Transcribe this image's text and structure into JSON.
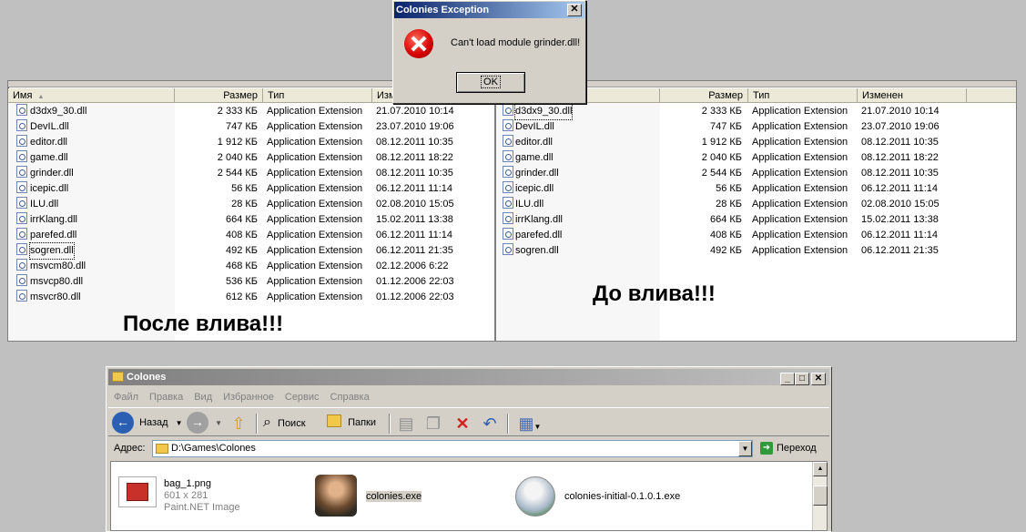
{
  "dialog": {
    "title": "Colonies Exception",
    "close": "✕",
    "message": "Can't load module grinder.dll!",
    "ok": "OK"
  },
  "left_panel": {
    "columns": {
      "name": "Имя",
      "size": "Размер",
      "type": "Тип",
      "modified": "Измен"
    },
    "files": [
      {
        "name": "d3dx9_30.dll",
        "size": "2 333 КБ",
        "type": "Application Extension",
        "date": "21.07.2010 10:14"
      },
      {
        "name": "DevIL.dll",
        "size": "747 КБ",
        "type": "Application Extension",
        "date": "23.07.2010 19:06"
      },
      {
        "name": "editor.dll",
        "size": "1 912 КБ",
        "type": "Application Extension",
        "date": "08.12.2011 10:35"
      },
      {
        "name": "game.dll",
        "size": "2 040 КБ",
        "type": "Application Extension",
        "date": "08.12.2011 18:22"
      },
      {
        "name": "grinder.dll",
        "size": "2 544 КБ",
        "type": "Application Extension",
        "date": "08.12.2011 10:35"
      },
      {
        "name": "icepic.dll",
        "size": "56 КБ",
        "type": "Application Extension",
        "date": "06.12.2011 11:14"
      },
      {
        "name": "ILU.dll",
        "size": "28 КБ",
        "type": "Application Extension",
        "date": "02.08.2010 15:05"
      },
      {
        "name": "irrKlang.dll",
        "size": "664 КБ",
        "type": "Application Extension",
        "date": "15.02.2011 13:38"
      },
      {
        "name": "parefed.dll",
        "size": "408 КБ",
        "type": "Application Extension",
        "date": "06.12.2011 11:14"
      },
      {
        "name": "sogren.dll",
        "size": "492 КБ",
        "type": "Application Extension",
        "date": "06.12.2011 21:35"
      },
      {
        "name": "msvcm80.dll",
        "size": "468 КБ",
        "type": "Application Extension",
        "date": "02.12.2006 6:22"
      },
      {
        "name": "msvcp80.dll",
        "size": "536 КБ",
        "type": "Application Extension",
        "date": "01.12.2006 22:03"
      },
      {
        "name": "msvcr80.dll",
        "size": "612 КБ",
        "type": "Application Extension",
        "date": "01.12.2006 22:03"
      }
    ],
    "caption": "После влива!!!"
  },
  "right_panel": {
    "columns": {
      "size": "Размер",
      "type": "Тип",
      "modified": "Изменен"
    },
    "files": [
      {
        "name": "d3dx9_30.dll",
        "size": "2 333 КБ",
        "type": "Application Extension",
        "date": "21.07.2010 10:14"
      },
      {
        "name": "DevIL.dll",
        "size": "747 КБ",
        "type": "Application Extension",
        "date": "23.07.2010 19:06"
      },
      {
        "name": "editor.dll",
        "size": "1 912 КБ",
        "type": "Application Extension",
        "date": "08.12.2011 10:35"
      },
      {
        "name": "game.dll",
        "size": "2 040 КБ",
        "type": "Application Extension",
        "date": "08.12.2011 18:22"
      },
      {
        "name": "grinder.dll",
        "size": "2 544 КБ",
        "type": "Application Extension",
        "date": "08.12.2011 10:35"
      },
      {
        "name": "icepic.dll",
        "size": "56 КБ",
        "type": "Application Extension",
        "date": "06.12.2011 11:14"
      },
      {
        "name": "ILU.dll",
        "size": "28 КБ",
        "type": "Application Extension",
        "date": "02.08.2010 15:05"
      },
      {
        "name": "irrKlang.dll",
        "size": "664 КБ",
        "type": "Application Extension",
        "date": "15.02.2011 13:38"
      },
      {
        "name": "parefed.dll",
        "size": "408 КБ",
        "type": "Application Extension",
        "date": "06.12.2011 11:14"
      },
      {
        "name": "sogren.dll",
        "size": "492 КБ",
        "type": "Application Extension",
        "date": "06.12.2011 21:35"
      }
    ],
    "caption": "До влива!!!"
  },
  "explorer": {
    "title": "Colones",
    "menu": [
      "Файл",
      "Правка",
      "Вид",
      "Избранное",
      "Сервис",
      "Справка"
    ],
    "toolbar": {
      "back": "Назад",
      "search": "Поиск",
      "folders": "Папки"
    },
    "address_label": "Адрес:",
    "address": "D:\\Games\\Colones",
    "go": "Переход",
    "items": [
      {
        "name": "bag_1.png",
        "dims": "601 x 281",
        "kind": "Paint.NET Image"
      },
      {
        "name": "colonies.exe"
      },
      {
        "name": "colonies-initial-0.1.0.1.exe"
      }
    ]
  },
  "colors": {
    "title_active": "#0a246a",
    "title_inactive": "#808080",
    "error": "#d40000",
    "window": "#d4d0c8"
  }
}
